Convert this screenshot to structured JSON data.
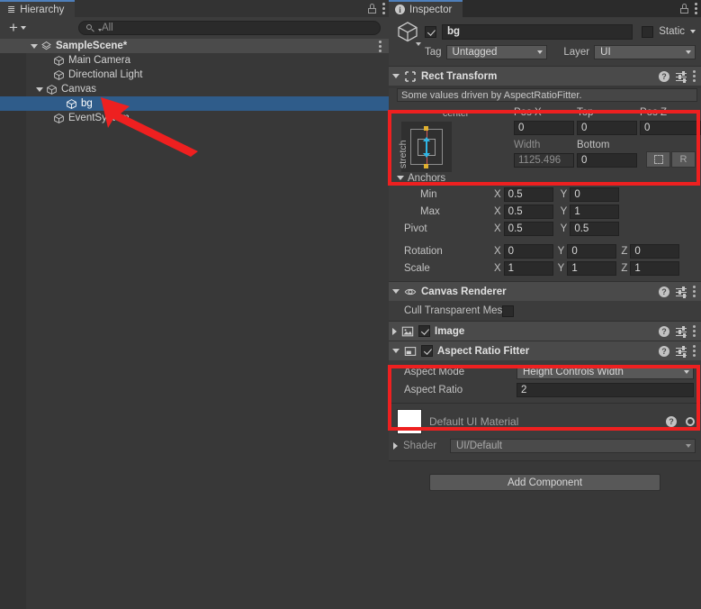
{
  "hierarchy": {
    "tab_label": "Hierarchy",
    "lock_icon": "lock-icon",
    "menu_icon": "kebab-menu-icon",
    "toolbar": {
      "create_label": "+",
      "search_placeholder": "All",
      "search_value": "",
      "search_icon": "search-icon"
    },
    "rows": [
      {
        "label": "SampleScene*",
        "depth": 0,
        "expanded": true,
        "icon": "scene-icon",
        "selected": false,
        "kind": "scene"
      },
      {
        "label": "Main Camera",
        "depth": 1,
        "expanded": null,
        "icon": "gameobject-cube-icon",
        "selected": false,
        "kind": "go"
      },
      {
        "label": "Directional Light",
        "depth": 1,
        "expanded": null,
        "icon": "gameobject-cube-icon",
        "selected": false,
        "kind": "go"
      },
      {
        "label": "Canvas",
        "depth": 1,
        "expanded": true,
        "icon": "gameobject-cube-icon",
        "selected": false,
        "kind": "go"
      },
      {
        "label": "bg",
        "depth": 2,
        "expanded": null,
        "icon": "gameobject-cube-icon",
        "selected": true,
        "kind": "go"
      },
      {
        "label": "EventSystem",
        "depth": 1,
        "expanded": null,
        "icon": "gameobject-cube-icon",
        "selected": false,
        "kind": "go"
      }
    ]
  },
  "inspector": {
    "tab_label": "Inspector",
    "info_icon": "info-icon",
    "lock_icon": "lock-icon",
    "menu_icon": "kebab-menu-icon",
    "gameobject": {
      "enabled": true,
      "name": "bg",
      "static_label": "Static",
      "static_checked": false,
      "tag_label": "Tag",
      "tag_value": "Untagged",
      "layer_label": "Layer",
      "layer_value": "UI",
      "icon": "gameobject-cube-icon"
    },
    "components": [
      {
        "title": "Rect Transform",
        "icon": "rect-transform-icon",
        "expanded": true,
        "has_checkbox": false,
        "info_message": "Some values driven by AspectRatioFitter.",
        "anchor_preset": {
          "horizontal": "center",
          "vertical": "stretch"
        },
        "fields": [
          {
            "label": "Pos X",
            "value": "0",
            "dim": false
          },
          {
            "label": "Top",
            "value": "0",
            "dim": false
          },
          {
            "label": "Pos Z",
            "value": "0",
            "dim": false
          },
          {
            "label": "Width",
            "value": "1125.496",
            "dim": true
          },
          {
            "label": "Bottom",
            "value": "0",
            "dim": false
          }
        ],
        "blueprint_button": "blueprint-mode-icon",
        "raw_button": "R",
        "anchors_label": "Anchors",
        "anchors": [
          {
            "label": "Min",
            "x": "0.5",
            "y": "0"
          },
          {
            "label": "Max",
            "x": "0.5",
            "y": "1"
          }
        ],
        "pivot": {
          "label": "Pivot",
          "x": "0.5",
          "y": "0.5"
        },
        "rotation": {
          "label": "Rotation",
          "x": "0",
          "y": "0",
          "z": "0"
        },
        "scale": {
          "label": "Scale",
          "x": "1",
          "y": "1",
          "z": "1"
        },
        "axis_x": "X",
        "axis_y": "Y",
        "axis_z": "Z"
      },
      {
        "title": "Canvas Renderer",
        "icon": "eye-icon",
        "expanded": true,
        "has_checkbox": false,
        "property_label": "Cull Transparent Mes",
        "property_checked": false
      },
      {
        "title": "Image",
        "icon": "image-icon",
        "expanded": false,
        "has_checkbox": true,
        "checked": true
      },
      {
        "title": "Aspect Ratio Fitter",
        "icon": "aspect-ratio-fitter-icon",
        "expanded": true,
        "has_checkbox": true,
        "checked": true,
        "aspect_mode_label": "Aspect Mode",
        "aspect_mode_value": "Height Controls Width",
        "aspect_ratio_label": "Aspect Ratio",
        "aspect_ratio_value": "2"
      }
    ],
    "material": {
      "name": "Default UI Material",
      "shader_label": "Shader",
      "shader_value": "UI/Default",
      "help_icon": "help-icon",
      "gear_icon": "gear-icon"
    },
    "add_component_label": "Add Component",
    "help_icon": "help-icon",
    "preset_icon": "preset-icon"
  },
  "annotations": {
    "arrow_color": "#ee2020",
    "box_color": "#ee2020",
    "arrow_name": "red-pointer-arrow",
    "boxes": [
      {
        "name": "highlight-rect-transform-position"
      },
      {
        "name": "highlight-aspect-ratio-fitter"
      }
    ]
  },
  "colors": {
    "panel_bg": "#383838",
    "header_bg": "#3c3c3c",
    "selection_blue": "#2f5c8a",
    "component_header": "#4a4a4a",
    "field_bg": "#2a2a2a",
    "annotation_red": "#ee2020"
  }
}
